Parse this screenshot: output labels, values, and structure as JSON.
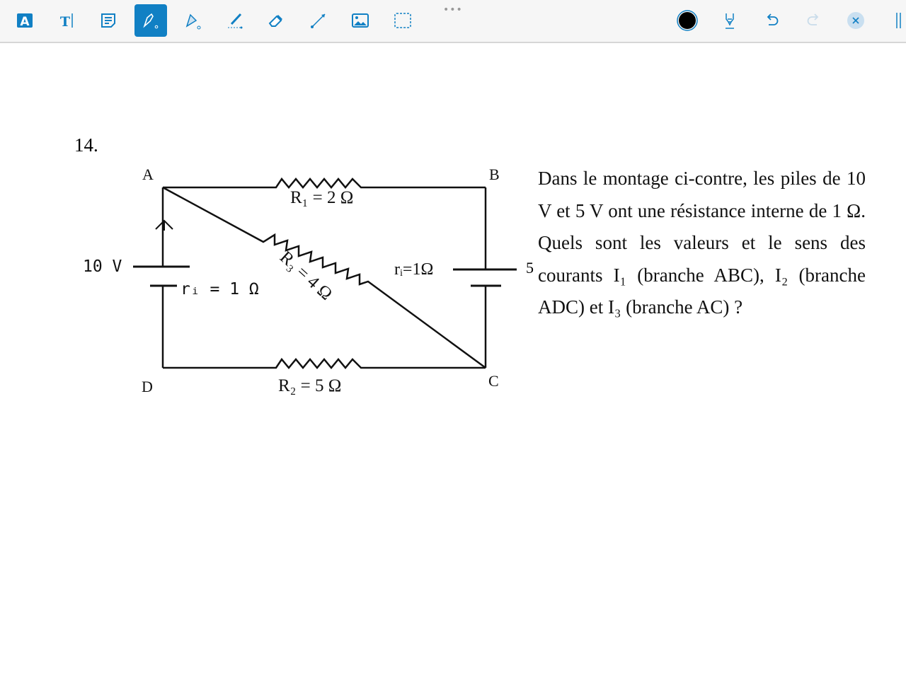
{
  "toolbar": {
    "tools": [
      {
        "icon": "text-box-icon",
        "label": "A"
      },
      {
        "icon": "text-cursor-icon",
        "label": "T"
      },
      {
        "icon": "note-icon"
      },
      {
        "icon": "pen-icon",
        "active": true
      },
      {
        "icon": "highlighter-icon"
      },
      {
        "icon": "smart-pen-icon"
      },
      {
        "icon": "eraser-icon"
      },
      {
        "icon": "line-icon"
      },
      {
        "icon": "image-icon"
      },
      {
        "icon": "selection-icon"
      }
    ],
    "more_label": "•••",
    "pen_color": "#000000",
    "accent": "#1180c4",
    "right_tools": [
      "color-icon",
      "pen-tip-icon",
      "undo-icon",
      "redo-icon",
      "close-icon",
      "pause-icon"
    ]
  },
  "problem": {
    "number": "14.",
    "text": "Dans le montage ci-contre, les piles de 10 V et 5 V ont une résistance interne de 1 Ω. Quels sont les valeurs et le sens des courants I₁ (branche ABC), I₂ (branche ADC) et I₃ (branche AC) ?",
    "cut_label": "5"
  },
  "circuit": {
    "nodes": {
      "a": "A",
      "b": "B",
      "c": "C",
      "d": "D"
    },
    "r1": "R₁ = 2 Ω",
    "r2": "R₂ = 5 Ω",
    "r3": "R₃ = 4 Ω",
    "source_left": "10 V",
    "ri_left": "rᵢ = 1 Ω",
    "ri_right": "rᵢ=1Ω"
  }
}
